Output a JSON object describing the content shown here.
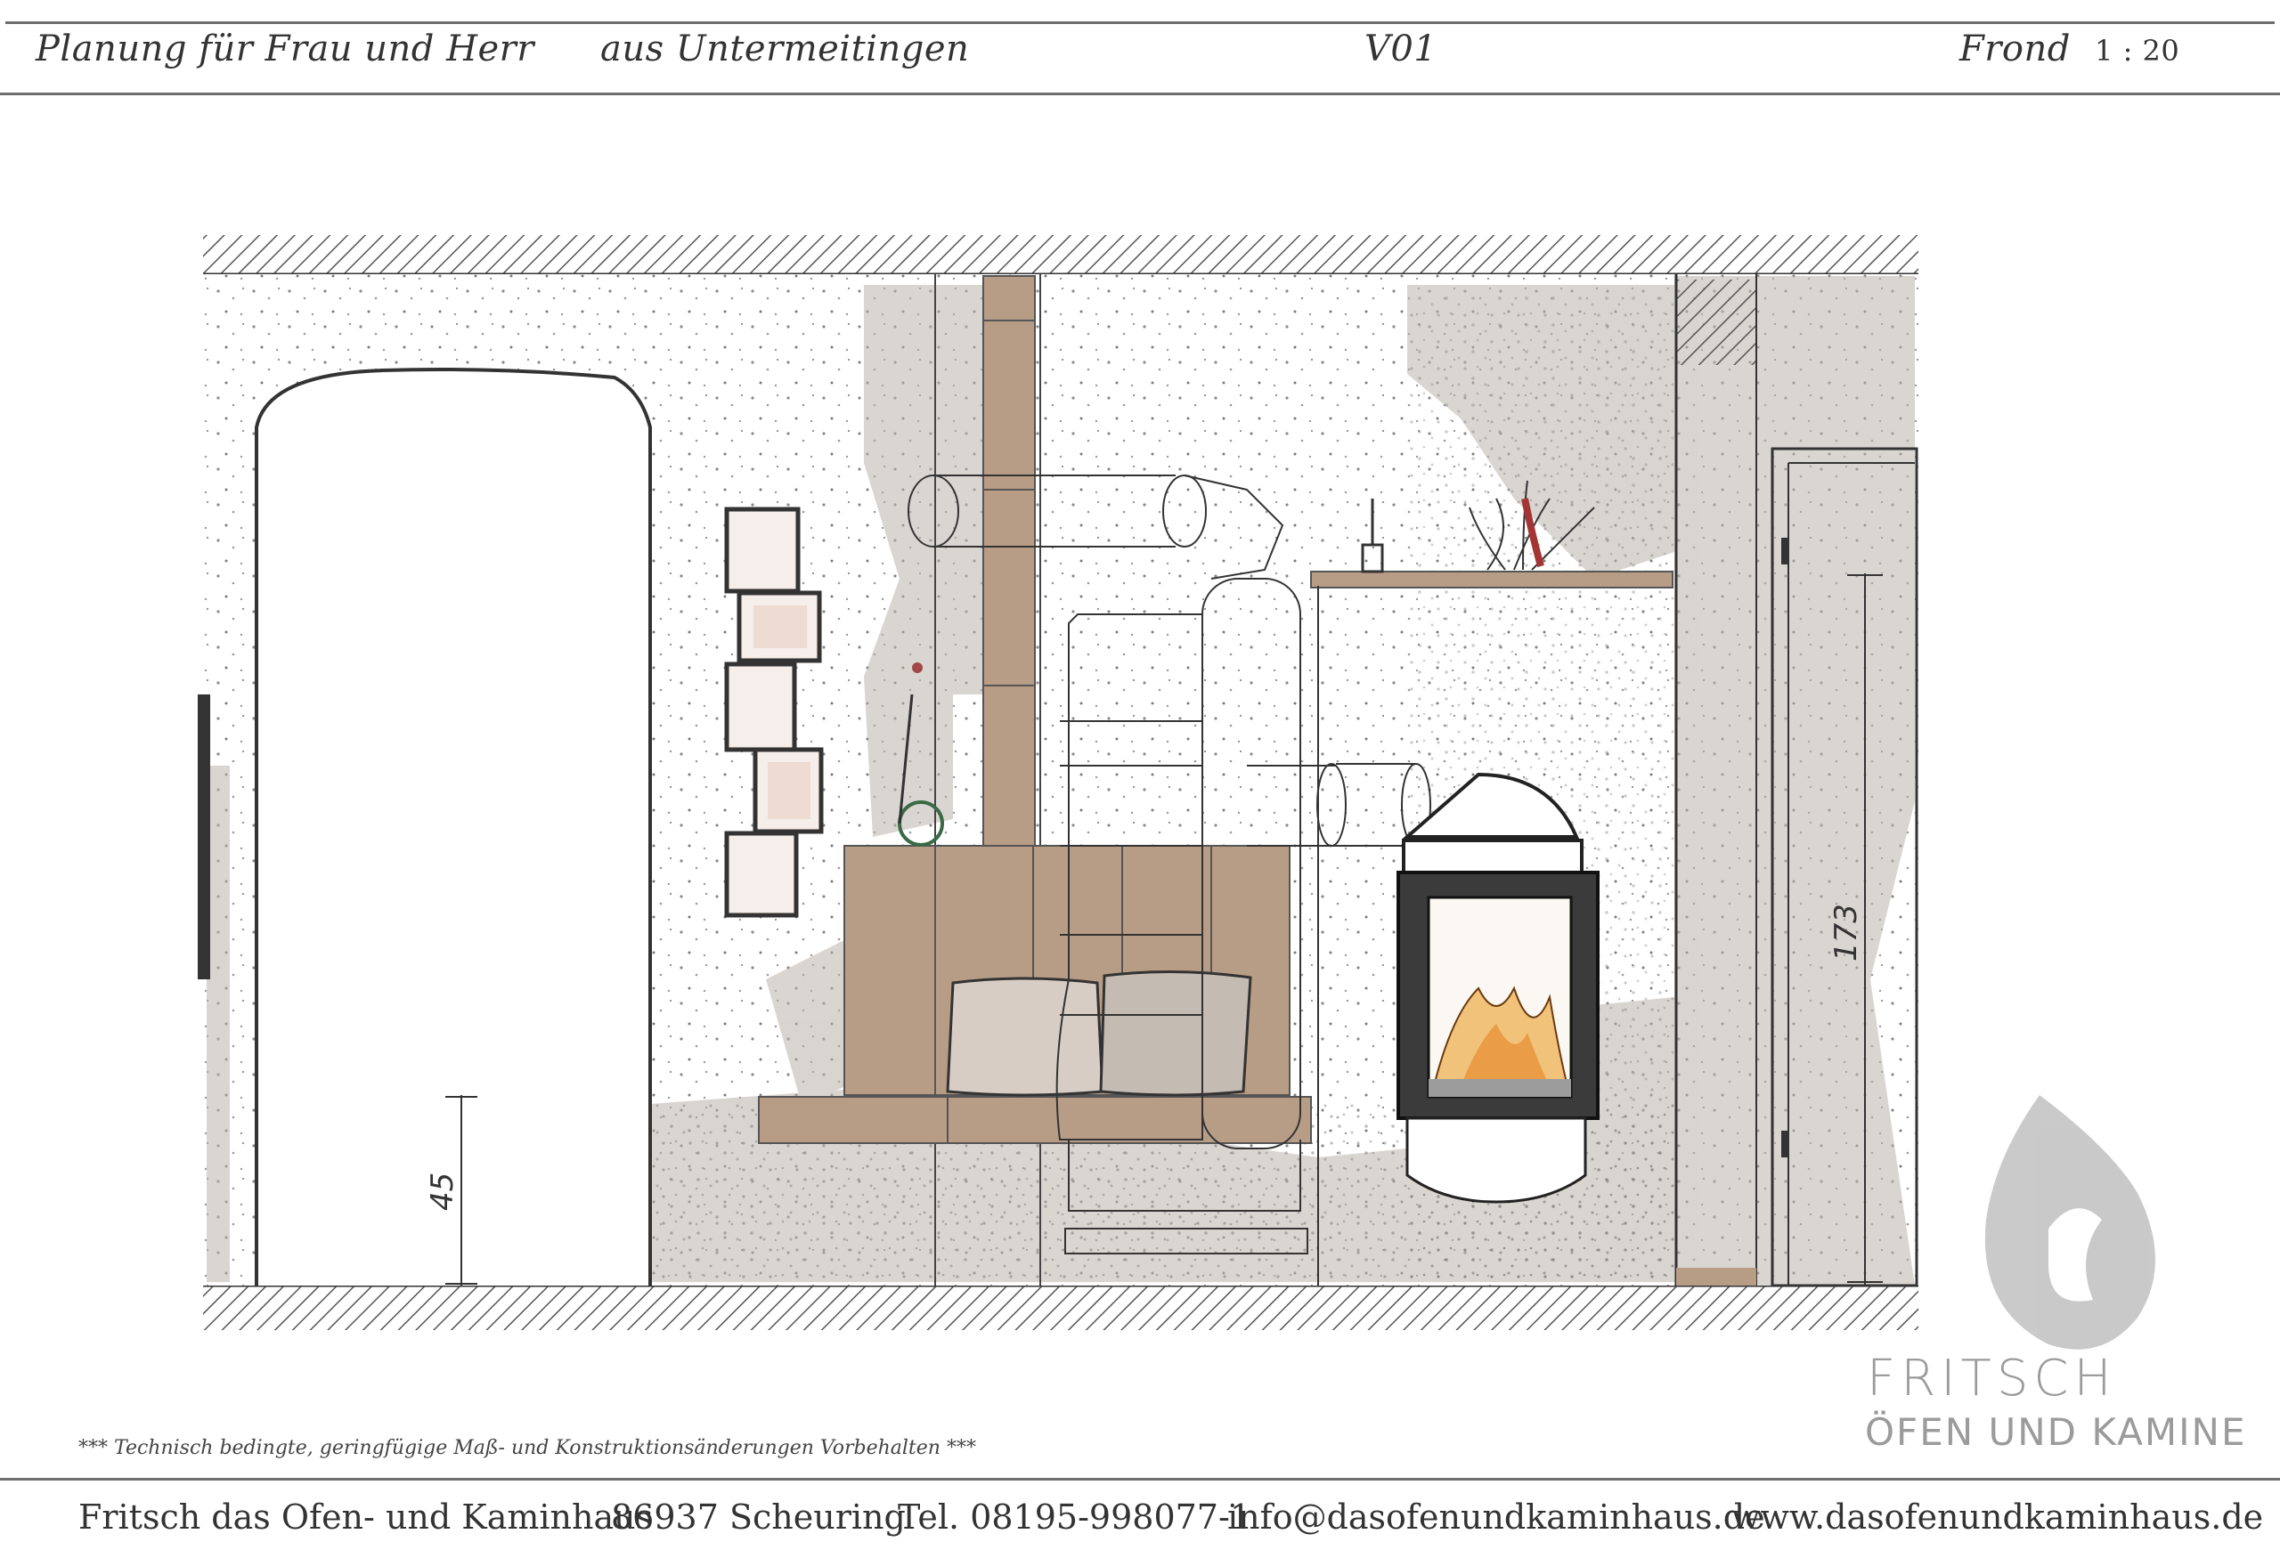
{
  "header": {
    "client": "Planung für Frau und Herr",
    "location": "aus Untermeitingen",
    "version": "V01",
    "view": "Frond",
    "scale": "1 : 20"
  },
  "drawing": {
    "dim_left": "45",
    "dim_right": "173"
  },
  "logo": {
    "name": "FRITSCH",
    "tagline": "ÖFEN UND KAMINE",
    "icon": "flame-icon"
  },
  "note": "***   Technisch bedingte, geringfügige Maß- und Konstruktionsänderungen Vorbehalten   ***",
  "footer": {
    "company": "Fritsch das Ofen- und Kaminhaus",
    "address": "86937 Scheuring",
    "phone": "Tel. 08195-998077-1",
    "email": "info@dasofenundkaminhaus.de",
    "web": "www.dasofenundkaminhaus.de"
  },
  "colors": {
    "wood": "#b49a83",
    "stone": "#a89f96",
    "line": "#3a3a3a",
    "logo_gray": "#a6a6a6"
  }
}
